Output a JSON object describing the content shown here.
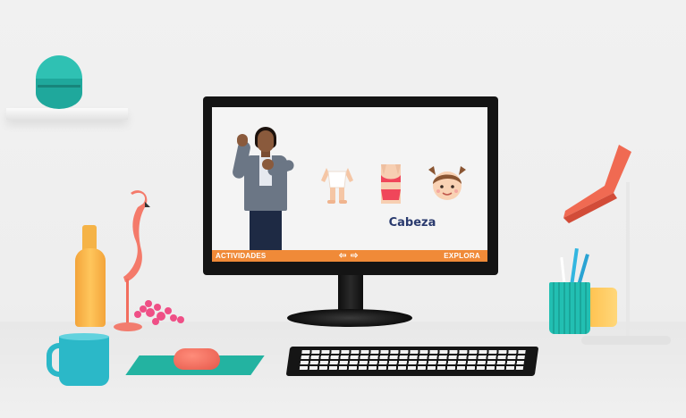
{
  "app": {
    "word": "Cabeza",
    "activities_label": "ACTIVIDADES",
    "logo_text": "EXPLORA",
    "nav": {
      "prev_symbol": "⇦",
      "next_symbol": "⇨"
    },
    "cards": [
      {
        "name": "legs"
      },
      {
        "name": "torso"
      },
      {
        "name": "head"
      }
    ]
  },
  "colors": {
    "bottom_bar": "#f08a38",
    "word_text": "#2a3a6e",
    "screen_bg": "#f4f4f4",
    "accent_teal": "#23b3a1",
    "accent_coral": "#e6584a"
  }
}
